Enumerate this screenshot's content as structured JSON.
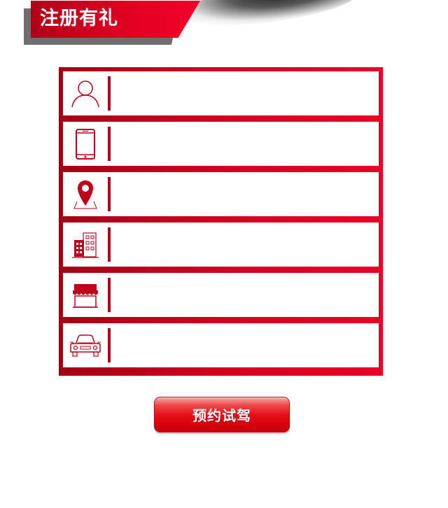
{
  "header": {
    "title": "注册有礼"
  },
  "colors": {
    "accent": "#d4001f",
    "accent_dark": "#a40014",
    "banner_shadow": "#6f6f6f",
    "button": "#e5121a"
  },
  "form": {
    "fields": [
      {
        "name": "name-field",
        "icon": "user-icon",
        "value": "",
        "placeholder": ""
      },
      {
        "name": "phone-field",
        "icon": "mobile-phone-icon",
        "value": "",
        "placeholder": ""
      },
      {
        "name": "province-field",
        "icon": "location-pin-icon",
        "value": "",
        "placeholder": ""
      },
      {
        "name": "city-field",
        "icon": "building-icon",
        "value": "",
        "placeholder": ""
      },
      {
        "name": "dealer-field",
        "icon": "store-icon",
        "value": "",
        "placeholder": ""
      },
      {
        "name": "car-model-field",
        "icon": "car-icon",
        "value": "",
        "placeholder": ""
      }
    ]
  },
  "submit": {
    "label": "预约试驾"
  }
}
